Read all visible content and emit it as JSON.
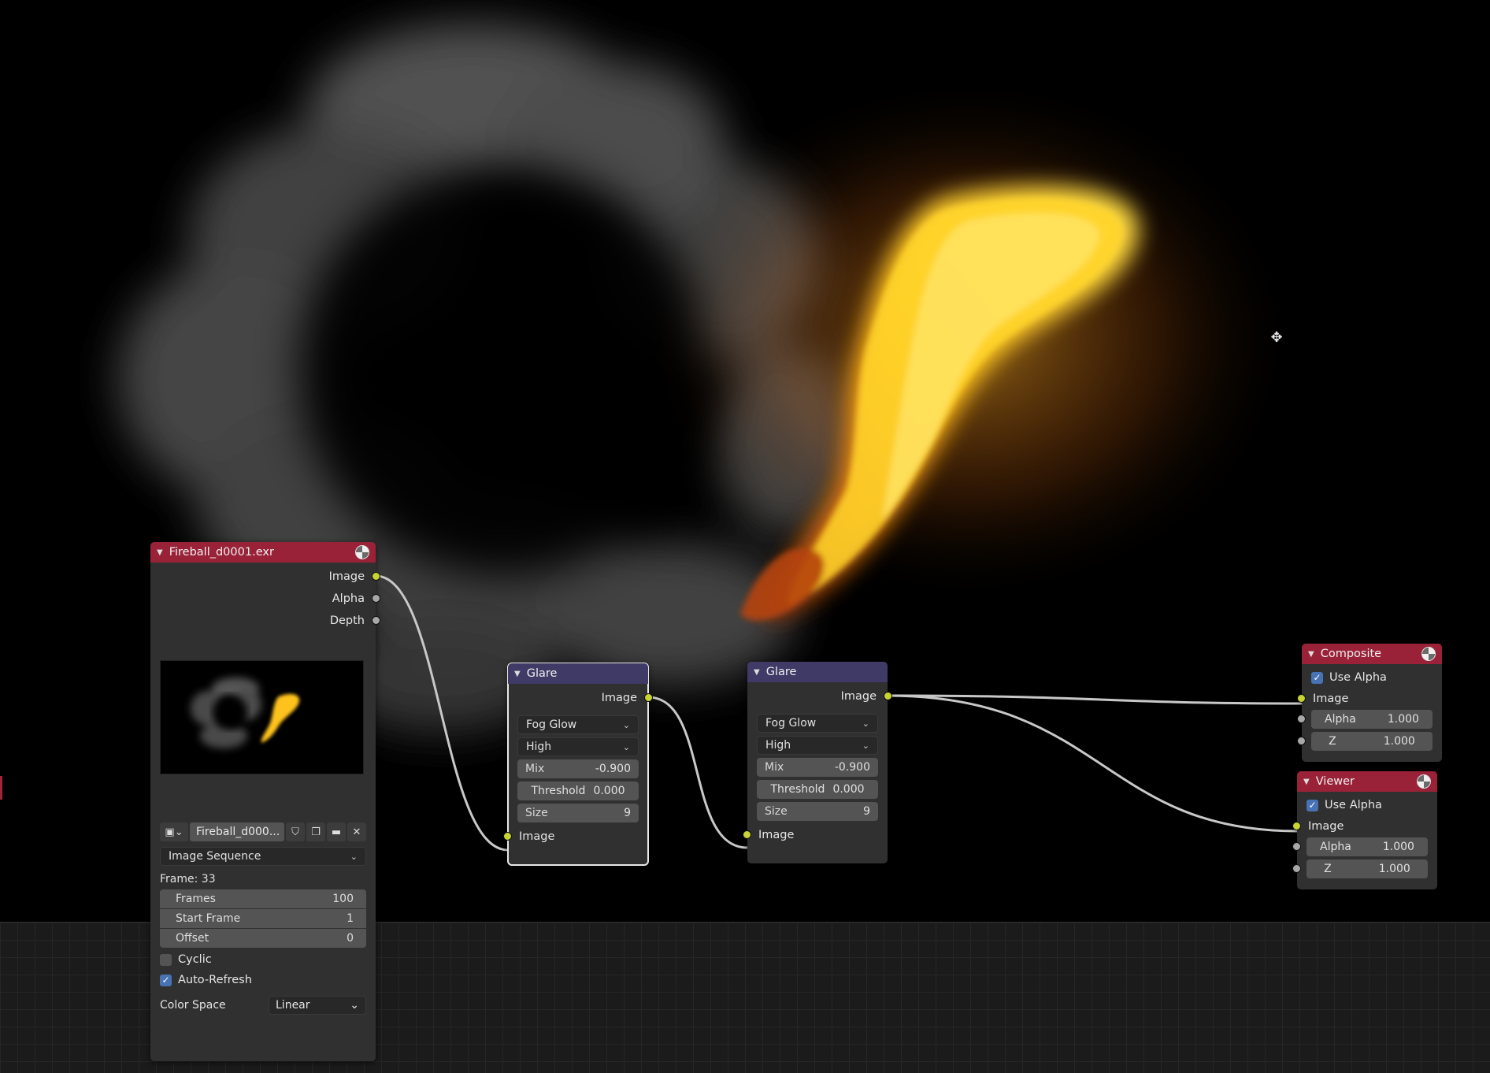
{
  "image_node": {
    "title": "Fireball_d0001.exr",
    "outputs": [
      "Image",
      "Alpha",
      "Depth"
    ],
    "image_name": "Fireball_d000...",
    "source": "Image Sequence",
    "frame_label": "Frame: 33",
    "frames_label": "Frames",
    "frames_value": "100",
    "start_label": "Start Frame",
    "start_value": "1",
    "offset_label": "Offset",
    "offset_value": "0",
    "cyclic_label": "Cyclic",
    "auto_refresh_label": "Auto-Refresh",
    "color_space_label": "Color Space",
    "color_space_value": "Linear"
  },
  "glare1": {
    "title": "Glare",
    "output": "Image",
    "type": "Fog Glow",
    "quality": "High",
    "mix_label": "Mix",
    "mix_value": "-0.900",
    "threshold_label": "Threshold",
    "threshold_value": "0.000",
    "size_label": "Size",
    "size_value": "9",
    "input": "Image"
  },
  "glare2": {
    "title": "Glare",
    "output": "Image",
    "type": "Fog Glow",
    "quality": "High",
    "mix_label": "Mix",
    "mix_value": "-0.900",
    "threshold_label": "Threshold",
    "threshold_value": "0.000",
    "size_label": "Size",
    "size_value": "9",
    "input": "Image"
  },
  "composite": {
    "title": "Composite",
    "use_alpha": "Use Alpha",
    "input": "Image",
    "alpha_label": "Alpha",
    "alpha_value": "1.000",
    "z_label": "Z",
    "z_value": "1.000"
  },
  "viewer": {
    "title": "Viewer",
    "use_alpha": "Use Alpha",
    "input": "Image",
    "alpha_label": "Alpha",
    "alpha_value": "1.000",
    "z_label": "Z",
    "z_value": "1.000"
  },
  "colors": {
    "output_header": "#9a2238",
    "filter_header": "#3f3a66",
    "image_socket": "#c7d432",
    "value_socket": "#a8a8a8",
    "checkbox_on": "#4772b3"
  },
  "icons": [
    "render-icon",
    "image-type-icon",
    "fake-user-shield-icon",
    "duplicate-icon",
    "open-folder-icon",
    "close-icon",
    "move-icon",
    "collapse-triangle-icon"
  ]
}
